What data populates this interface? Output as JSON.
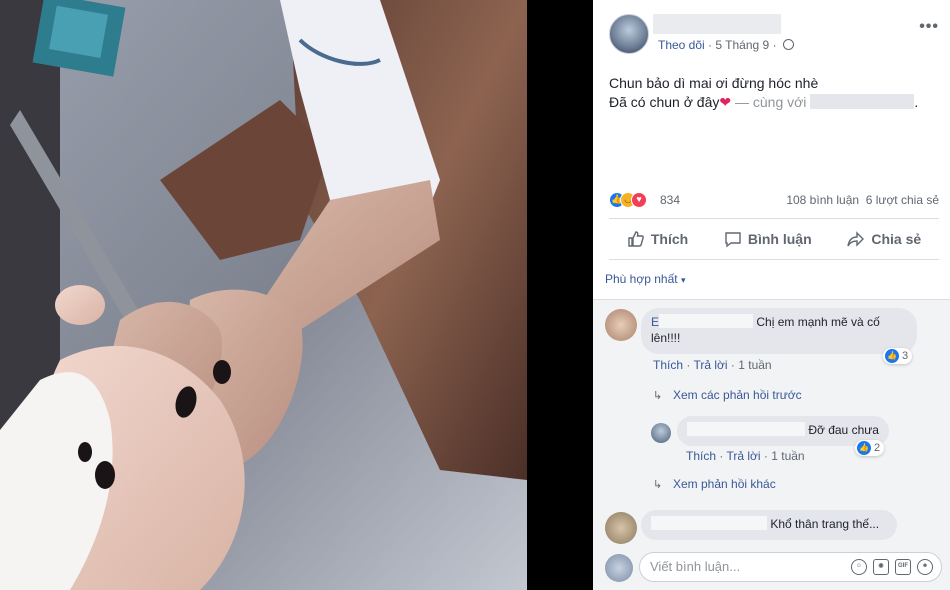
{
  "post": {
    "follow_label": "Theo dõi",
    "date": "5 Tháng 9",
    "separator": "·",
    "line1": "Chun bảo dì mai ơi đừng hóc nhè",
    "line2": "Đã có chun ở đây",
    "with_text": "— cùng với",
    "period": ".",
    "more_label": "•••"
  },
  "reactions": {
    "count": "834",
    "comments": "108 bình luận",
    "shares": "6 lượt chia sẻ"
  },
  "actions": {
    "like": "Thích",
    "comment": "Bình luận",
    "share": "Chia sẻ"
  },
  "sort": {
    "label": "Phù hợp nhất",
    "caret": "▾"
  },
  "comments": [
    {
      "initial": "E",
      "text": "Chị em mạnh mẽ và cố lên!!!!",
      "like": "Thích",
      "reply": "Trả lời",
      "time": "1 tuần",
      "likes": "3",
      "view_prev": "Xem các phản hồi trước"
    },
    {
      "text": "Đỡ đau chưa",
      "like": "Thích",
      "reply": "Trả lời",
      "time": "1 tuần",
      "likes": "2",
      "view_more": "Xem phản hồi khác"
    },
    {
      "text": "Khổ thân trang thế..."
    }
  ],
  "input": {
    "placeholder": "Viết bình luận..."
  },
  "colors": {
    "link": "#385898",
    "meta": "#606770",
    "like_blue": "#1877f2",
    "heart": "#e0245e",
    "comment_bg": "#f2f3f5"
  }
}
